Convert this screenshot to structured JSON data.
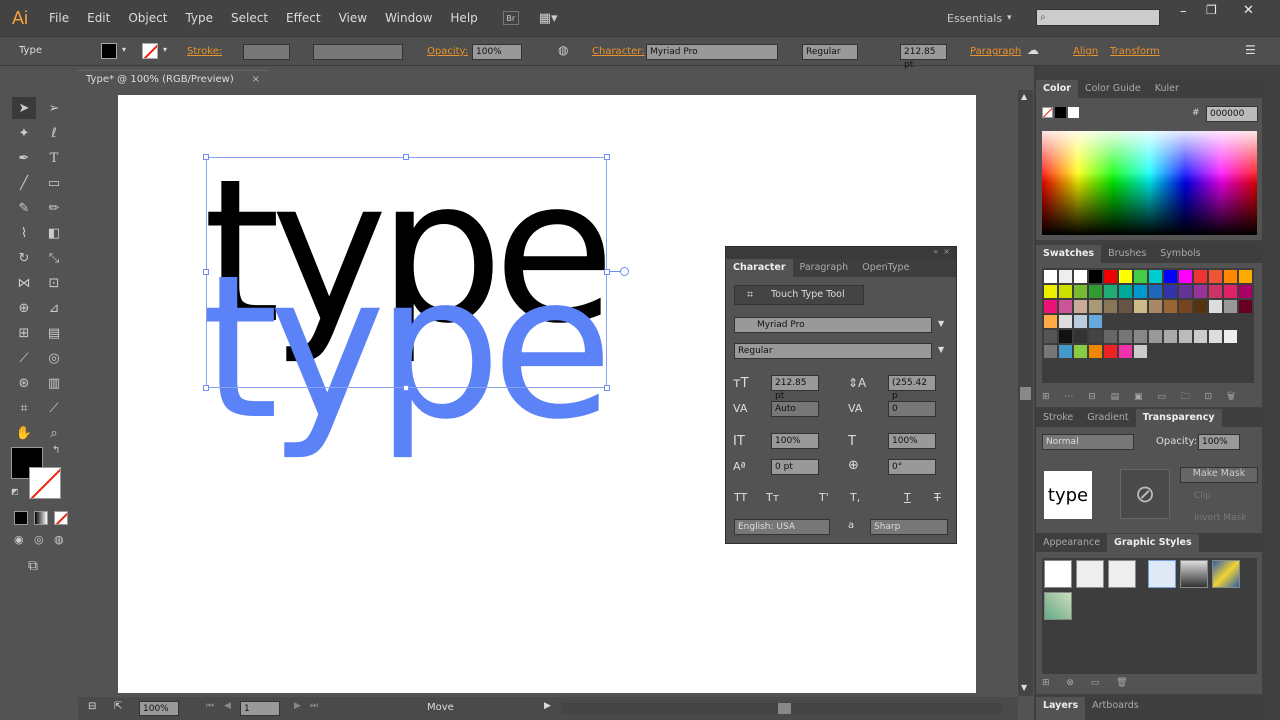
{
  "app": {
    "logo": "Ai"
  },
  "menu": [
    "File",
    "Edit",
    "Object",
    "Type",
    "Select",
    "Effect",
    "View",
    "Window",
    "Help"
  ],
  "workspace": "Essentials",
  "control": {
    "selection_type": "Type",
    "stroke_label": "Stroke:",
    "opacity_label": "Opacity:",
    "opacity_value": "100%",
    "character_label": "Character:",
    "font": "Myriad Pro",
    "style": "Regular",
    "size": "212.85 pt",
    "paragraph_label": "Paragraph",
    "align_label": "Align",
    "transform_label": "Transform"
  },
  "document": {
    "tab": "Type* @ 100% (RGB/Preview)"
  },
  "canvas": {
    "text_black": "type",
    "text_blue": "type",
    "blue_color": "#5b82f7"
  },
  "character_panel": {
    "tabs": [
      "Character",
      "Paragraph",
      "OpenType"
    ],
    "touch_tool": "Touch Type Tool",
    "font": "Myriad Pro",
    "style": "Regular",
    "size": "212.85 pt",
    "leading": "(255.42 p",
    "kerning": "Auto",
    "tracking": "0",
    "vscale": "100%",
    "hscale": "100%",
    "baseline": "0 pt",
    "rotation": "0°",
    "language": "English: USA",
    "aa_label": "a",
    "antialias": "Sharp"
  },
  "color_panel": {
    "tabs": [
      "Color",
      "Color Guide",
      "Kuler"
    ],
    "hex": "000000"
  },
  "swatches_panel": {
    "tabs": [
      "Swatches",
      "Brushes",
      "Symbols"
    ]
  },
  "transparency_panel": {
    "tabs": [
      "Stroke",
      "Gradient",
      "Transparency"
    ],
    "blend": "Normal",
    "opacity_label": "Opacity:",
    "opacity": "100%",
    "thumb_text": "type",
    "make_mask": "Make Mask",
    "clip": "Clip",
    "invert": "Invert Mask"
  },
  "graphic_styles_panel": {
    "tabs": [
      "Appearance",
      "Graphic Styles"
    ]
  },
  "layers_panel": {
    "tabs": [
      "Layers",
      "Artboards"
    ]
  },
  "status": {
    "zoom": "100%",
    "artboard": "1",
    "tool": "Move"
  }
}
